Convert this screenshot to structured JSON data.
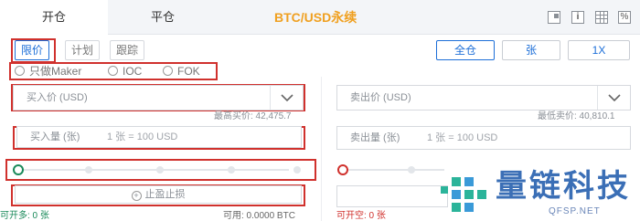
{
  "header": {
    "tab_open": "开仓",
    "tab_close": "平仓",
    "title": "BTC/USD永续",
    "icons": [
      "window-icon",
      "info-icon",
      "calculator-icon",
      "percent-icon"
    ],
    "info_icon_glyph": "i",
    "percent_icon_glyph": "%"
  },
  "order_types": [
    "限价",
    "计划",
    "跟踪"
  ],
  "position_modes": {
    "all": "全仓",
    "contracts": "张",
    "leverage": "1X"
  },
  "tif_options": [
    "只做Maker",
    "IOC",
    "FOK"
  ],
  "buy": {
    "price_placeholder": "买入价 (USD)",
    "max_buy_label": "最高买价: 42,475.7",
    "qty_placeholder": "买入量 (张)",
    "qty_hint": "1 张 = 100 USD",
    "stop_profit_loss": "止盈止损",
    "can_open": "可开多: 0 张",
    "available": "可用: 0.0000 BTC"
  },
  "sell": {
    "price_placeholder": "卖出价 (USD)",
    "min_sell_label": "最低卖价: 40,810.1",
    "qty_placeholder": "卖出量 (张)",
    "qty_hint": "1 张 = 100 USD",
    "can_open": "可开空: 0 张"
  },
  "colors": {
    "accent": "#1d6fd8",
    "title": "#f0a020",
    "buy": "#1a8a5a",
    "sell": "#d0312d",
    "highlight_box": "#d0312d"
  },
  "watermark": {
    "cn": "量链科技",
    "en": "QFSP.NET"
  }
}
